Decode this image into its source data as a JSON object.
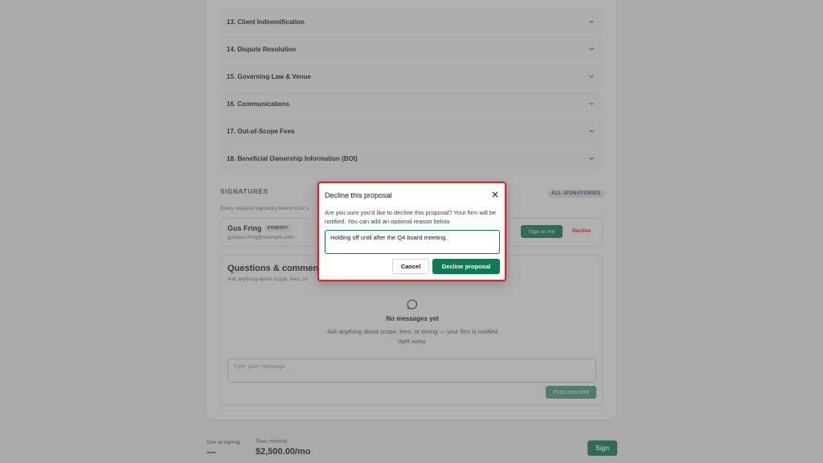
{
  "sections": [
    {
      "label": "13. Client Indemnification"
    },
    {
      "label": "14. Dispute Resolution"
    },
    {
      "label": "15. Governing Law & Venue"
    },
    {
      "label": "16. Communications"
    },
    {
      "label": "17. Out-of-Scope Fees"
    },
    {
      "label": "18. Beneficial Ownership Information (BOI)"
    }
  ],
  "signatures": {
    "heading": "SIGNATURES",
    "badge": "ALL SIGNATORIES",
    "note": "Every required signatory below must s",
    "signer": {
      "name": "Gus Fring",
      "role_badge": "PRIMARY",
      "email": "gustavo.fring@example.com",
      "sign_label": "Sign as me",
      "decline_label": "Decline"
    }
  },
  "questions": {
    "title": "Questions & comments",
    "subtitle": "Ask anything about scope, fees, or",
    "empty_title": "No messages yet",
    "empty_desc": "Ask anything about scope, fees, or timing — your firm is notified right away.",
    "input_placeholder": "Type your message...",
    "post_label": "Post comment"
  },
  "footer": {
    "due_label": "Due at signing",
    "due_value": "—",
    "monthly_label": "Then monthly",
    "monthly_value": "$2,500.00/mo",
    "sign_label": "Sign"
  },
  "modal": {
    "title": "Decline this proposal",
    "body": "Are you sure you'd like to decline this proposal? Your firm will be notified. You can add an optional reason below.",
    "reason_value": "Holding off until after the Q4 board meeting.",
    "cancel_label": "Cancel",
    "confirm_label": "Decline proposal"
  },
  "colors": {
    "accent": "#0f7a55",
    "danger": "#dc2626"
  }
}
